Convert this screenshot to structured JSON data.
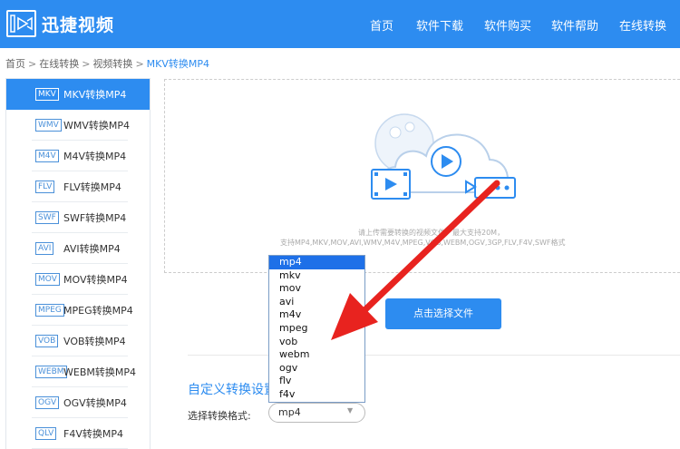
{
  "header": {
    "brand": "迅捷视频",
    "nav": [
      "首页",
      "软件下载",
      "软件购买",
      "软件帮助",
      "在线转换"
    ]
  },
  "breadcrumb": {
    "items": [
      "首页",
      "在线转换",
      "视频转换"
    ],
    "current": "MKV转换MP4",
    "separator": ">"
  },
  "sidebar": {
    "items": [
      {
        "tag": "MKV",
        "label": "MKV转换MP4",
        "active": true
      },
      {
        "tag": "WMV",
        "label": "WMV转换MP4"
      },
      {
        "tag": "M4V",
        "label": "M4V转换MP4"
      },
      {
        "tag": "FLV",
        "label": "FLV转换MP4"
      },
      {
        "tag": "SWF",
        "label": "SWF转换MP4"
      },
      {
        "tag": "AVI",
        "label": "AVI转换MP4"
      },
      {
        "tag": "MOV",
        "label": "MOV转换MP4"
      },
      {
        "tag": "MPEG",
        "label": "MPEG转换MP4"
      },
      {
        "tag": "VOB",
        "label": "VOB转换MP4"
      },
      {
        "tag": "WEBM",
        "label": "WEBM转换MP4"
      },
      {
        "tag": "OGV",
        "label": "OGV转换MP4"
      },
      {
        "tag": "QLV",
        "label": "F4V转换MP4"
      }
    ]
  },
  "upload": {
    "hint_line1": "请上传需要转换的视频文件，最大支持20M，",
    "hint_line2": "支持MP4,MKV,MOV,AVI,WMV,M4V,MPEG,VOB,WEBM,OGV,3GP,FLV,F4V,SWF格式",
    "select_button": "点击选择文件"
  },
  "settings": {
    "title": "自定义转换设置",
    "format_label": "选择转换格式:",
    "format_value": "mp4",
    "options": [
      "mp4",
      "mkv",
      "mov",
      "avi",
      "m4v",
      "mpeg",
      "vob",
      "webm",
      "ogv",
      "flv",
      "f4v"
    ]
  },
  "colors": {
    "brand_blue": "#2d8cf0",
    "annotation_arrow": "#e8231f"
  }
}
